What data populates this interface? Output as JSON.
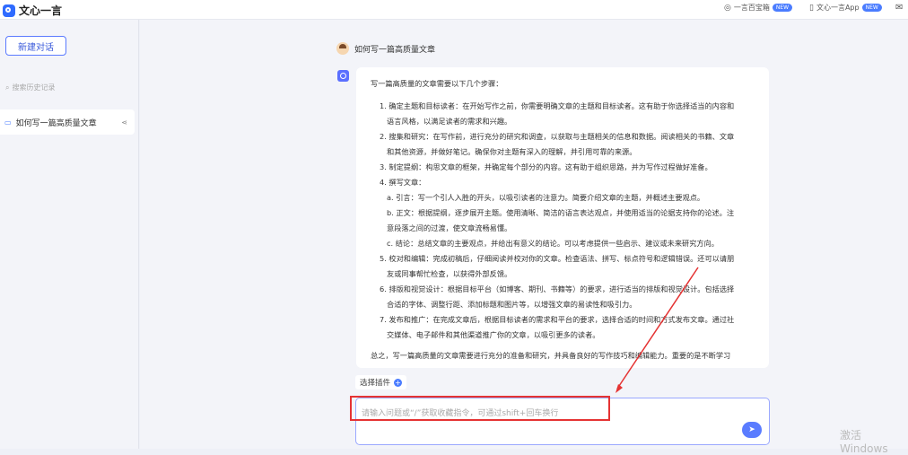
{
  "app": {
    "title": "文心一言"
  },
  "topbar": {
    "item1": {
      "label": "一言百宝箱",
      "badge": "NEW"
    },
    "item2": {
      "label": "文心一言App",
      "badge": "NEW"
    }
  },
  "sidebar": {
    "new_chat": "新建对话",
    "search_placeholder": "搜索历史记录",
    "history": [
      {
        "label": "如何写一篇高质量文章"
      }
    ]
  },
  "chat": {
    "question": "如何写一篇高质量文章",
    "answer": {
      "intro": "写一篇高质量的文章需要以下几个步骤：",
      "lines": [
        {
          "text": "1. 确定主题和目标读者：在开始写作之前，你需要明确文章的主题和目标读者。这有助于你选择适当的内容和",
          "cls": "indent"
        },
        {
          "text": "语言风格，以满足读者的需求和兴趣。",
          "cls": "indent2"
        },
        {
          "text": "2. 搜集和研究：在写作前，进行充分的研究和调查，以获取与主题相关的信息和数据。阅读相关的书籍、文章",
          "cls": "indent"
        },
        {
          "text": "和其他资源，并做好笔记。确保你对主题有深入的理解，并引用可靠的来源。",
          "cls": "indent2"
        },
        {
          "text": "3. 制定提纲：构思文章的框架，并确定每个部分的内容。这有助于组织思路，并为写作过程做好准备。",
          "cls": "indent"
        },
        {
          "text": "4. 撰写文章：",
          "cls": "indent"
        },
        {
          "text": "a. 引言：写一个引人入胜的开头，以吸引读者的注意力。简要介绍文章的主题，并概述主要观点。",
          "cls": "indent2"
        },
        {
          "text": "b. 正文：根据提纲，逐步展开主题。使用清晰、简洁的语言表达观点，并使用适当的论据支持你的论述。注",
          "cls": "indent2"
        },
        {
          "text": "意段落之间的过渡，使文章流畅易懂。",
          "cls": "indent2"
        },
        {
          "text": "c. 结论：总结文章的主要观点，并给出有意义的结论。可以考虑提供一些启示、建议或未来研究方向。",
          "cls": "indent2"
        },
        {
          "text": "5. 校对和编辑：完成初稿后，仔细阅读并校对你的文章。检查语法、拼写、标点符号和逻辑错误。还可以请朋",
          "cls": "indent"
        },
        {
          "text": "友或同事帮忙检查，以获得外部反馈。",
          "cls": "indent2"
        },
        {
          "text": "6. 排版和视觉设计：根据目标平台（如博客、期刊、书籍等）的要求，进行适当的排版和视觉设计。包括选择",
          "cls": "indent"
        },
        {
          "text": "合适的字体、调整行距、添加标题和图片等，以增强文章的易读性和吸引力。",
          "cls": "indent2"
        },
        {
          "text": "7. 发布和推广：在完成文章后，根据目标读者的需求和平台的要求，选择合适的时间和方式发布文章。通过社",
          "cls": "indent"
        },
        {
          "text": "交媒体、电子邮件和其他渠道推广你的文章，以吸引更多的读者。",
          "cls": "indent2"
        },
        {
          "text": "总之，写一篇高质量的文章需要进行充分的准备和研究，并具备良好的写作技巧和编辑能力。重要的是不断学习",
          "cls": ""
        }
      ]
    }
  },
  "input": {
    "plugin_label": "选择插件",
    "placeholder": "请输入问题或“/”获取收藏指令，可通过shift+回车换行"
  },
  "watermark": "激活 Windows",
  "colors": {
    "accent": "#4a7cff",
    "highlight": "#e53333"
  }
}
